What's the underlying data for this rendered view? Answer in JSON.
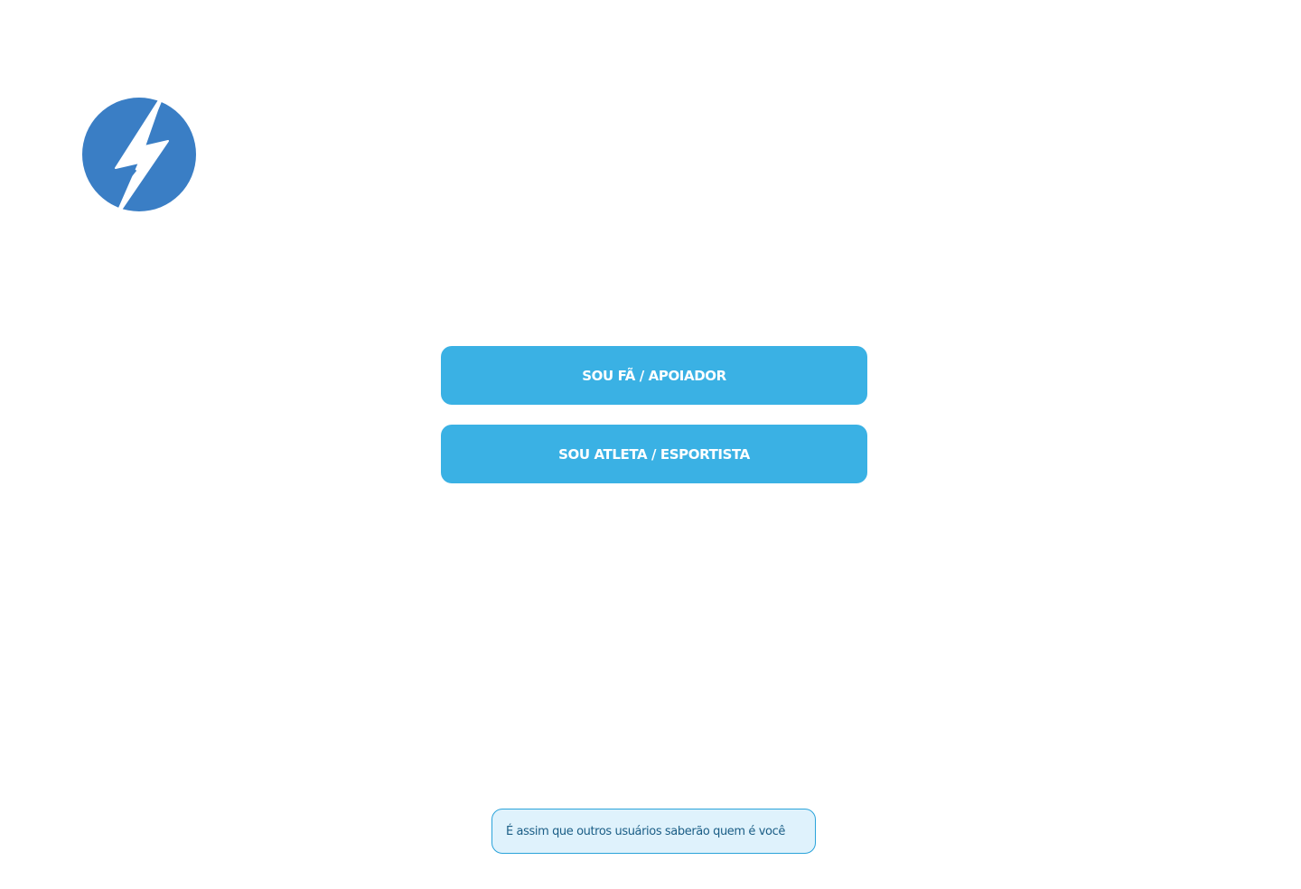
{
  "brand": {
    "logo_icon": "lightning-bolt-circle-icon",
    "logo_color": "#3A7EC5"
  },
  "role_selection": {
    "fan_button_label": "SOU FÃ / APOIADOR",
    "athlete_button_label": "SOU ATLETA / ESPORTISTA",
    "button_color": "#3AB1E4"
  },
  "hint": {
    "text": "É assim que outros usuários saberão quem é você",
    "background_color": "#DFF2FC",
    "border_color": "#2AA3DA"
  }
}
